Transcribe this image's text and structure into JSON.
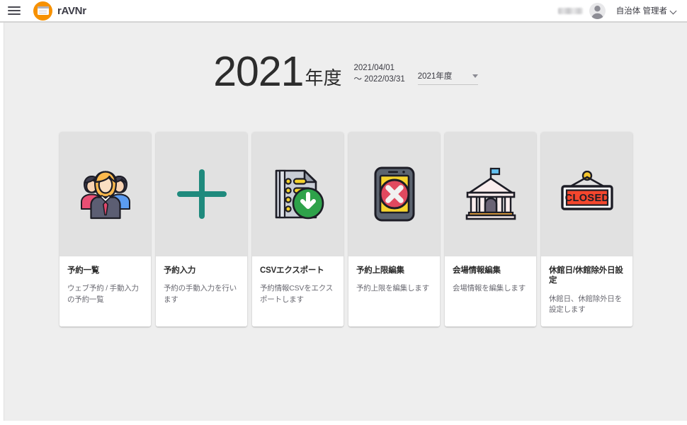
{
  "header": {
    "menu_icon": "hamburger-menu-icon",
    "brand_name": "rAVNr",
    "brand_icon": "browser-window-icon",
    "user_name_redacted": "",
    "avatar_icon": "user-avatar-icon",
    "account_label": "自治体 管理者",
    "account_chevron_icon": "chevron-down-icon"
  },
  "title": {
    "year": "2021",
    "year_suffix": "年度",
    "range_start": "2021/04/01",
    "range_end": "～ 2022/03/31"
  },
  "year_select": {
    "value": "2021年度",
    "caret_icon": "caret-down-icon",
    "options": [
      "2021年度"
    ]
  },
  "cards": [
    {
      "id": "reservation-list",
      "icon": "people-group-icon",
      "title": "予約一覧",
      "desc": "ウェブ予約 / 手動入力の予約一覧"
    },
    {
      "id": "reservation-input",
      "icon": "plus-icon",
      "title": "予約入力",
      "desc": "予約の手動入力を行います"
    },
    {
      "id": "csv-export",
      "icon": "document-download-icon",
      "title": "CSVエクスポート",
      "desc": "予約情報CSVをエクスポートします"
    },
    {
      "id": "reservation-limit-edit",
      "icon": "phone-blocked-icon",
      "title": "予約上限編集",
      "desc": "予約上限を編集します"
    },
    {
      "id": "venue-info-edit",
      "icon": "town-hall-icon",
      "title": "会場情報編集",
      "desc": "会場情報を編集します"
    },
    {
      "id": "closed-days-settings",
      "icon": "closed-sign-icon",
      "title": "休館日/休館除外日設定",
      "desc": "休館日、休館除外日を設定します"
    }
  ],
  "colors": {
    "brand_orange": "#f79100",
    "accent_teal": "#1f8a7d",
    "content_bg": "#eeeeee",
    "card_media_bg": "#e1e1e1",
    "closed_red": "#f4462d",
    "download_green": "#2ea24a"
  }
}
